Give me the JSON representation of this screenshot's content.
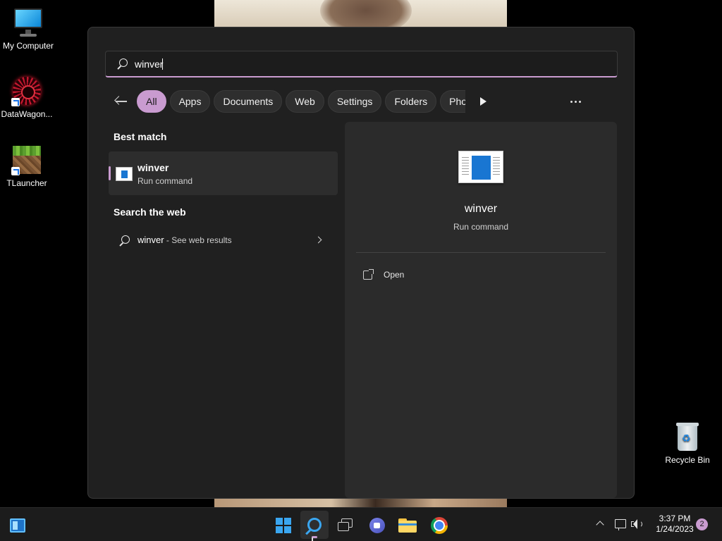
{
  "desktop": {
    "icons": [
      {
        "label": "My Computer"
      },
      {
        "label": "DataWagon..."
      },
      {
        "label": "TLauncher"
      },
      {
        "label": "Recycle Bin"
      }
    ]
  },
  "search": {
    "query": "winver",
    "filters": [
      "All",
      "Apps",
      "Documents",
      "Web",
      "Settings",
      "Folders",
      "Pho"
    ],
    "active_filter": "All",
    "best_match_heading": "Best match",
    "best_match": {
      "title": "winver",
      "subtitle": "Run command"
    },
    "web_heading": "Search the web",
    "web_result": {
      "query": "winver",
      "suffix": " - See web results"
    },
    "preview": {
      "title": "winver",
      "subtitle": "Run command",
      "open_label": "Open"
    }
  },
  "taskbar": {
    "time": "3:37 PM",
    "date": "1/24/2023",
    "notification_count": "2"
  },
  "colors": {
    "accent": "#c99bd0",
    "panel": "#202020",
    "taskbar": "#1c1c1c"
  }
}
